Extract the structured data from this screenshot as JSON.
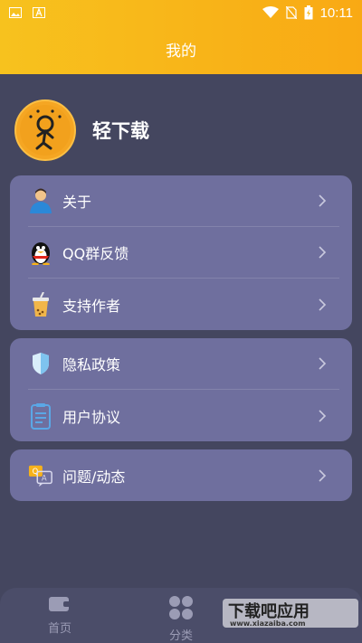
{
  "statusbar": {
    "time": "10:11",
    "left_icons": [
      "image-icon",
      "a-letter-icon"
    ],
    "right_icons": [
      "wifi-icon",
      "no-sim-icon",
      "battery-charging-icon"
    ]
  },
  "header": {
    "title": "我的"
  },
  "profile": {
    "name": "轻下载"
  },
  "menu_group_1": [
    {
      "label": "关于",
      "icon": "person-icon"
    },
    {
      "label": "QQ群反馈",
      "icon": "qq-penguin-icon"
    },
    {
      "label": "支持作者",
      "icon": "drink-cup-icon"
    }
  ],
  "menu_group_2": [
    {
      "label": "隐私政策",
      "icon": "privacy-shield-icon"
    },
    {
      "label": "用户协议",
      "icon": "document-icon"
    }
  ],
  "menu_group_3": [
    {
      "label": "问题/动态",
      "icon": "chat-bubbles-icon"
    }
  ],
  "bottom_nav": [
    {
      "label": "首页",
      "icon": "wallet-icon"
    },
    {
      "label": "分类",
      "icon": "grid-icon"
    }
  ],
  "watermark": {
    "text": "下载吧应用",
    "domain": "www.xiazaiba.com"
  },
  "colors": {
    "header_gradient": [
      "#f7c21e",
      "#f9a914"
    ],
    "background": "#44465f",
    "card": "#6f6f9e"
  }
}
